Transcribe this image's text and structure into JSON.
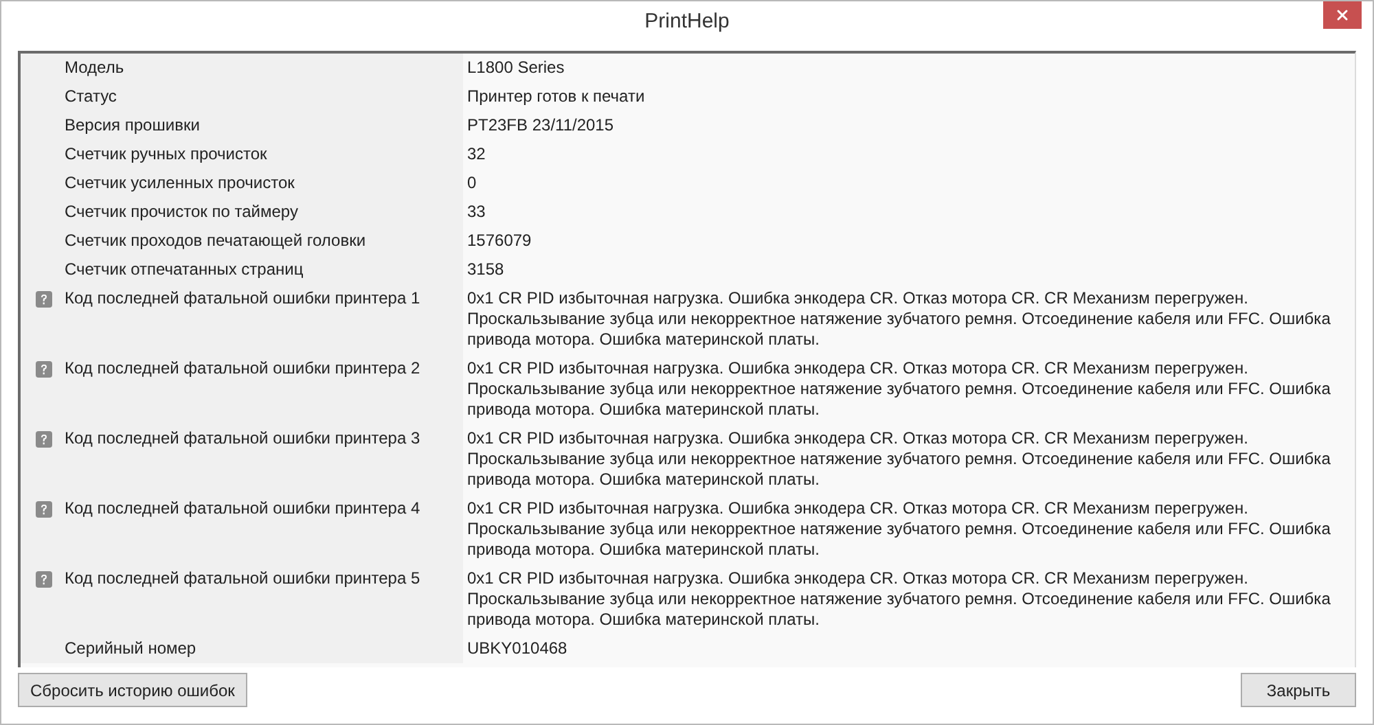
{
  "window": {
    "title": "PrintHelp"
  },
  "properties": [
    {
      "kind": "plain",
      "label": "Модель",
      "value": "L1800 Series"
    },
    {
      "kind": "plain",
      "label": "Статус",
      "value": "Принтер готов к печати"
    },
    {
      "kind": "plain",
      "label": "Версия прошивки",
      "value": "PT23FB 23/11/2015"
    },
    {
      "kind": "plain",
      "label": "Счетчик ручных прочисток",
      "value": "32"
    },
    {
      "kind": "plain",
      "label": "Счетчик усиленных прочисток",
      "value": "0"
    },
    {
      "kind": "plain",
      "label": "Счетчик прочисток по таймеру",
      "value": "33"
    },
    {
      "kind": "plain",
      "label": "Счетчик проходов печатающей головки",
      "value": "1576079"
    },
    {
      "kind": "plain",
      "label": "Счетчик отпечатанных страниц",
      "value": "3158"
    },
    {
      "kind": "error",
      "label": "Код последней фатальной ошибки принтера 1",
      "value": "0x1 CR PID избыточная нагрузка. Ошибка энкодера CR. Отказ мотора CR. CR Механизм перегружен. Проскальзывание зубца или некорректное натяжение зубчатого ремня. Отсоединение кабеля или FFC. Ошибка привода мотора. Ошибка материнской платы."
    },
    {
      "kind": "error",
      "label": "Код последней фатальной ошибки принтера 2",
      "value": "0x1 CR PID избыточная нагрузка. Ошибка энкодера CR. Отказ мотора CR. CR Механизм перегружен. Проскальзывание зубца или некорректное натяжение зубчатого ремня. Отсоединение кабеля или FFC. Ошибка привода мотора. Ошибка материнской платы."
    },
    {
      "kind": "error",
      "label": "Код последней фатальной ошибки принтера 3",
      "value": "0x1 CR PID избыточная нагрузка. Ошибка энкодера CR. Отказ мотора CR. CR Механизм перегружен. Проскальзывание зубца или некорректное натяжение зубчатого ремня. Отсоединение кабеля или FFC. Ошибка привода мотора. Ошибка материнской платы."
    },
    {
      "kind": "error",
      "label": "Код последней фатальной ошибки принтера 4",
      "value": "0x1 CR PID избыточная нагрузка. Ошибка энкодера CR. Отказ мотора CR. CR Механизм перегружен. Проскальзывание зубца или некорректное натяжение зубчатого ремня. Отсоединение кабеля или FFC. Ошибка привода мотора. Ошибка материнской платы."
    },
    {
      "kind": "error",
      "label": "Код последней фатальной ошибки принтера 5",
      "value": "0x1 CR PID избыточная нагрузка. Ошибка энкодера CR. Отказ мотора CR. CR Механизм перегружен. Проскальзывание зубца или некорректное натяжение зубчатого ремня. Отсоединение кабеля или FFC. Ошибка привода мотора. Ошибка материнской платы."
    },
    {
      "kind": "plain",
      "label": "Серийный номер",
      "value": "UBKY010468"
    }
  ],
  "buttons": {
    "reset": "Сбросить историю ошибок",
    "close": "Закрыть"
  }
}
